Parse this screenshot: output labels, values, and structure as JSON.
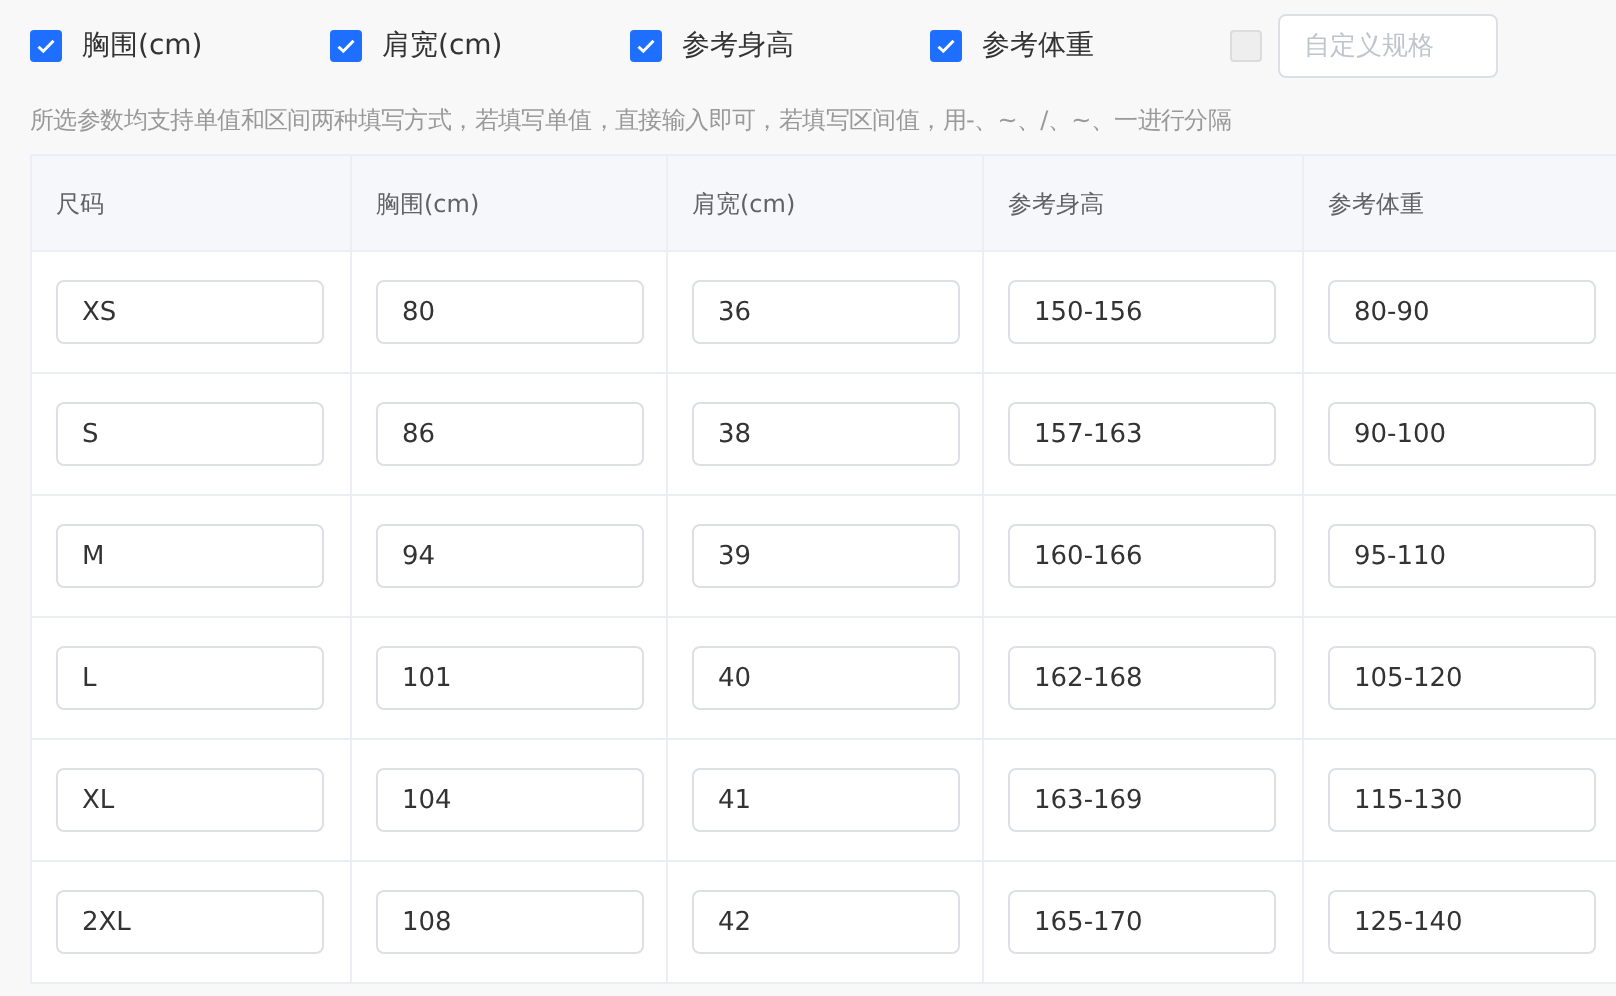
{
  "options": [
    {
      "kind": "preset",
      "label": "胸围(cm)",
      "checked": true
    },
    {
      "kind": "preset",
      "label": "肩宽(cm)",
      "checked": true
    },
    {
      "kind": "preset",
      "label": "参考身高",
      "checked": true
    },
    {
      "kind": "preset",
      "label": "参考体重",
      "checked": true
    },
    {
      "kind": "custom",
      "checked": false,
      "disabled": true,
      "placeholder": "自定义规格"
    }
  ],
  "hint": "所选参数均支持单值和区间两种填写方式，若填写单值，直接输入即可，若填写区间值，用-、~、/、~、一进行分隔",
  "table": {
    "columns": [
      "尺码",
      "胸围(cm)",
      "肩宽(cm)",
      "参考身高",
      "参考体重"
    ],
    "rows": [
      [
        "XS",
        "80",
        "36",
        "150-156",
        "80-90"
      ],
      [
        "S",
        "86",
        "38",
        "157-163",
        "90-100"
      ],
      [
        "M",
        "94",
        "39",
        "160-166",
        "95-110"
      ],
      [
        "L",
        "101",
        "40",
        "162-168",
        "105-120"
      ],
      [
        "XL",
        "104",
        "41",
        "163-169",
        "115-130"
      ],
      [
        "2XL",
        "108",
        "42",
        "165-170",
        "125-140"
      ]
    ]
  }
}
